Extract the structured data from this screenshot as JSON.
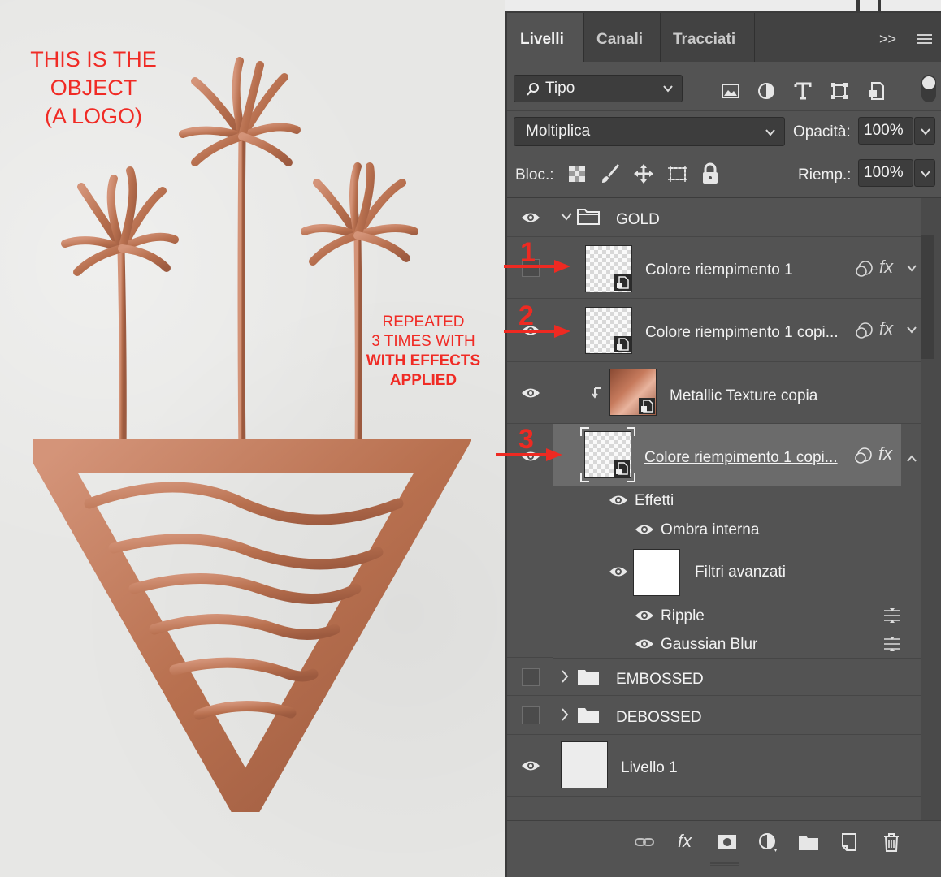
{
  "notes": {
    "object_lines": [
      "THIS IS THE",
      "OBJECT",
      "(A LOGO)"
    ],
    "repeated_lines": [
      "REPEATED",
      "3 TIMES WITH"
    ],
    "repeated_bold_lines": [
      "WITH EFFECTS",
      "APPLIED"
    ],
    "color": "#f02b25"
  },
  "logo": {
    "icon": "palm-island-logo",
    "color": "#c07a5e"
  },
  "panel": {
    "tabs": [
      "Livelli",
      "Canali",
      "Tracciati"
    ],
    "overflow": ">>",
    "filter": {
      "label": "Tipo",
      "icons": [
        "image-filter-icon",
        "adjustment-filter-icon",
        "type-filter-icon",
        "shape-filter-icon",
        "smart-object-filter-icon"
      ]
    },
    "blend": {
      "mode": "Moltiplica",
      "opacity_label": "Opacità:",
      "opacity": "100%"
    },
    "lock": {
      "label": "Bloc.:",
      "fill_label": "Riemp.:",
      "fill": "100%"
    },
    "layers": {
      "gold": "GOLD",
      "fill1": "Colore riempimento 1",
      "fill1_copy": "Colore riempimento 1 copi...",
      "metallic": "Metallic Texture copia",
      "fill1_copy2": "Colore riempimento 1 copi...",
      "effects": "Effetti",
      "inner_shadow": "Ombra interna",
      "smart_filters": "Filtri avanzati",
      "ripple": "Ripple",
      "gaussian": "Gaussian Blur",
      "embossed": "EMBOSSED",
      "debossed": "DEBOSSED",
      "level1": "Livello 1"
    },
    "fx_label": "fx",
    "markers": [
      "1",
      "2",
      "3"
    ],
    "marker_color": "#ee2a22"
  }
}
